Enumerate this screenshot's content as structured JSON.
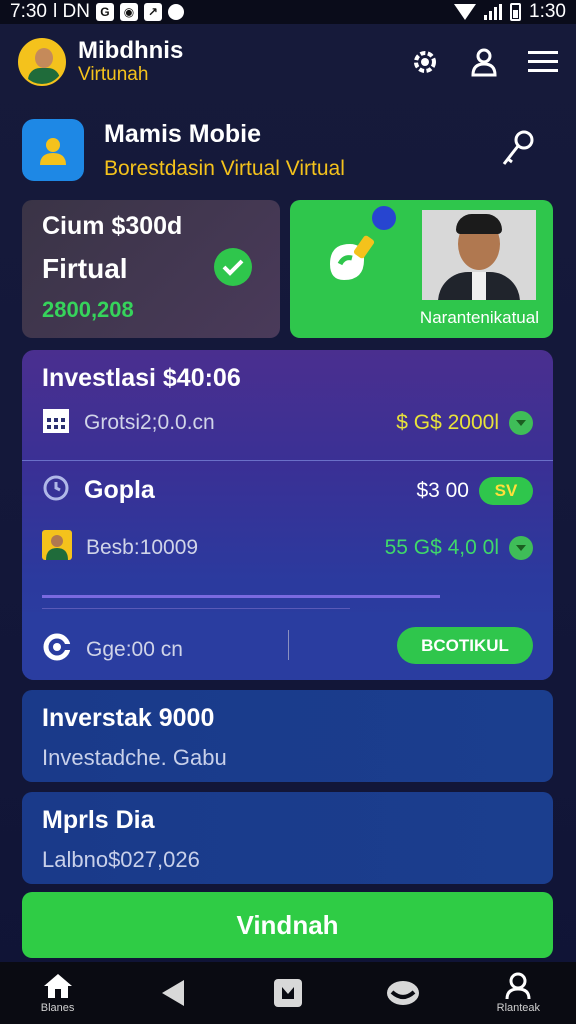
{
  "status_bar": {
    "time": "7:30",
    "carrier": "l DN",
    "time_right": "1:30"
  },
  "header": {
    "brand_name": "Mibdhnis",
    "brand_sub": "Virtunah"
  },
  "app_card": {
    "title": "Mamis Mobie",
    "subtitle": "Borestdasin Virtual Virtual"
  },
  "balance_card": {
    "line1": "Cium $300d",
    "line2": "Firtual",
    "amount": "2800,208"
  },
  "green_card": {
    "caption": "Narantenikatual"
  },
  "investment": {
    "title": "Investlasi $40:06",
    "row1": {
      "label": "Grotsi2;0.0.cn",
      "value": "$ G$ 2000l"
    },
    "row2": {
      "label": "Gopla",
      "value": "$3 00",
      "pill": "SV"
    },
    "row3": {
      "label": "Besb:10009",
      "value": "55 G$ 4,0 0l"
    },
    "row4": {
      "label": "Gge:00 cn",
      "button": "BCOTIKUL"
    }
  },
  "info1": {
    "title": "Inverstak 9000",
    "sub": "Investadche. Gabu"
  },
  "info2": {
    "title": "Mprls Dia",
    "sub": "Lalbno$027,026"
  },
  "main_button": "Vindnah",
  "nav": {
    "home": "Blanes",
    "profile": "Rlanteak"
  }
}
